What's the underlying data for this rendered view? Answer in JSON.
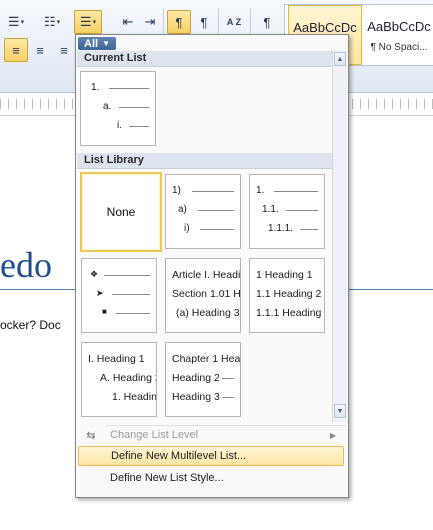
{
  "ribbon": {
    "style_tiles": [
      {
        "sample": "AaBbCcDc",
        "name": ""
      },
      {
        "sample": "AaBbCcDc",
        "name": "¶ No Spaci..."
      }
    ],
    "pilcrow": "¶",
    "sort_label": "A Z"
  },
  "document": {
    "heading": "edo",
    "body": "ocker? Doc"
  },
  "dropdown": {
    "filter_label": "All",
    "current_list_header": "Current List",
    "current_list": [
      "1.",
      "a.",
      "i."
    ],
    "library_header": "List Library",
    "none_label": "None",
    "tiles": {
      "numeric_paren": [
        "1)",
        "a)",
        "i)"
      ],
      "decimal": [
        "1.",
        "1.1.",
        "1.1.1."
      ],
      "article": [
        "Article I. Headi",
        "Section 1.01 H",
        "(a) Heading 3"
      ],
      "heading_numbered": [
        "1 Heading 1",
        "1.1 Heading 2",
        "1.1.1 Heading"
      ],
      "heading_roman": [
        "I. Heading 1",
        "A. Heading 2",
        "1. Headin"
      ],
      "chapter": [
        "Chapter 1 Hea",
        "Heading 2",
        "Heading 3"
      ]
    },
    "menu": {
      "change_level": "Change List Level",
      "define_list": "Define New Multilevel List...",
      "define_style": "Define New List Style..."
    }
  }
}
